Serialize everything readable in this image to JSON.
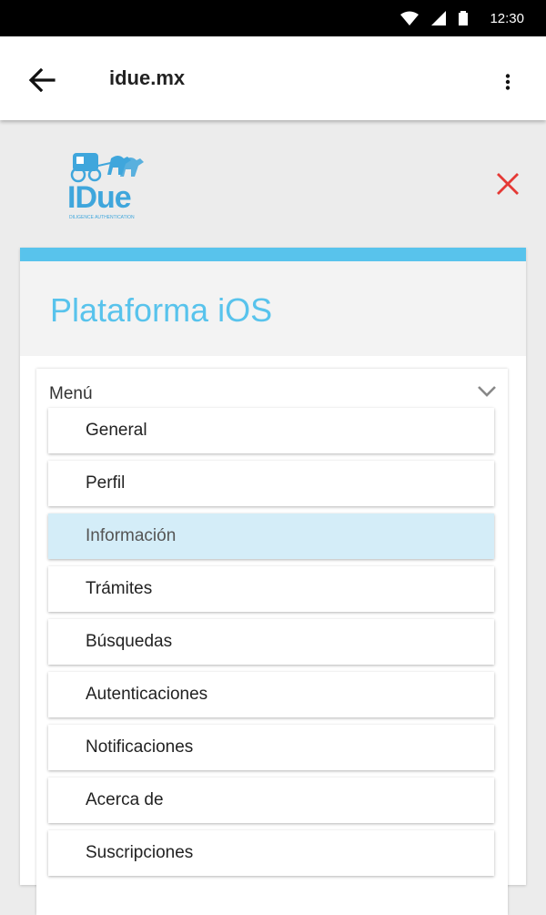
{
  "status_bar": {
    "time": "12:30",
    "icons": [
      "wifi-icon",
      "signal-icon",
      "battery-icon"
    ]
  },
  "app_bar": {
    "title": "idue.mx",
    "back_icon": "arrow-left-icon",
    "menu_icon": "more-vert-icon"
  },
  "logo": {
    "text": "IDue",
    "tagline": "DILIGENCE AUTHENTICATION"
  },
  "close_icon": "close-icon",
  "panel": {
    "title": "Plataforma iOS",
    "menu": {
      "label": "Menú",
      "chevron_icon": "chevron-down-icon",
      "items": [
        {
          "label": "General"
        },
        {
          "label": "Perfil"
        },
        {
          "label": "Información",
          "active": true
        },
        {
          "label": "Trámites"
        },
        {
          "label": "Búsquedas"
        },
        {
          "label": "Autenticaciones"
        },
        {
          "label": "Notificaciones"
        },
        {
          "label": "Acerca de"
        },
        {
          "label": "Suscripciones"
        }
      ]
    }
  },
  "colors": {
    "accent": "#58c3ec",
    "active_item": "#d4edf8",
    "close": "#e53935",
    "logo": "#3fa6dc"
  }
}
